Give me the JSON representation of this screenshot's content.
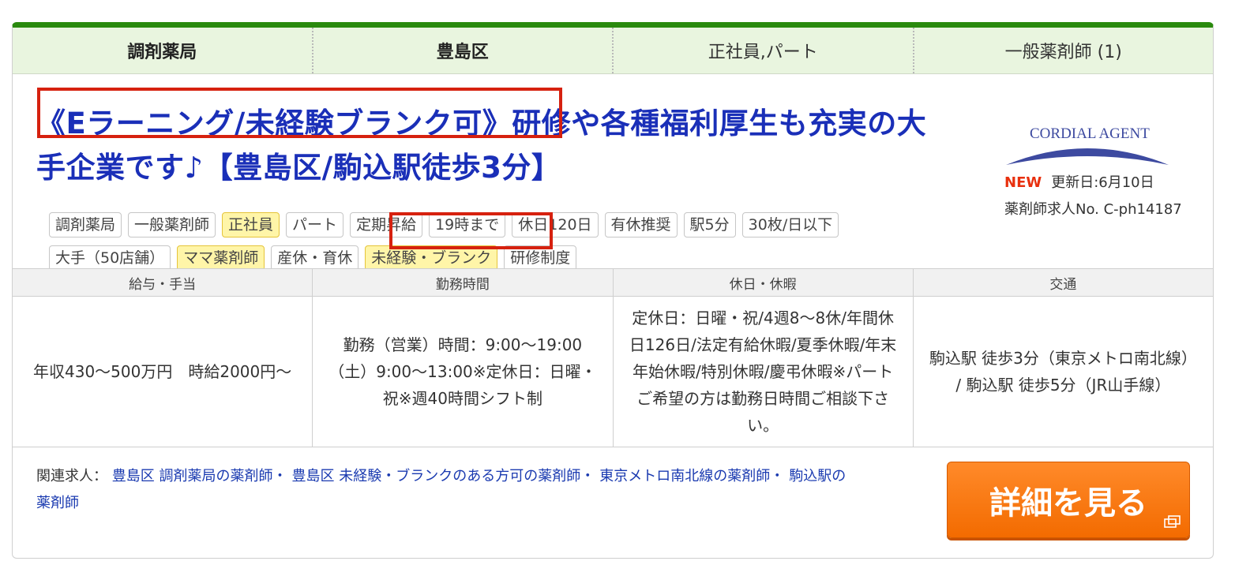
{
  "categories": [
    {
      "label": "調剤薬局",
      "bold": true
    },
    {
      "label": "豊島区",
      "bold": true
    },
    {
      "label": "正社員,パート",
      "bold": false
    },
    {
      "label": "一般薬剤師 (1)",
      "bold": false
    }
  ],
  "title": "《Eラーニング/未経験ブランク可》研修や各種福利厚生も充実の大手企業です♪【豊島区/駒込駅徒歩3分】",
  "logo_text": "CORDIAL AGENT",
  "badge_new": "NEW",
  "updated": "更新日:6月10日",
  "job_no": "薬剤師求人No. C-ph14187",
  "tags_row1": [
    {
      "label": "調剤薬局",
      "yellow": false
    },
    {
      "label": "一般薬剤師",
      "yellow": false
    },
    {
      "label": "正社員",
      "yellow": true
    },
    {
      "label": "パート",
      "yellow": false
    },
    {
      "label": "定期昇給",
      "yellow": false
    },
    {
      "label": "19時まで",
      "yellow": false
    },
    {
      "label": "休日120日",
      "yellow": false
    },
    {
      "label": "有休推奨",
      "yellow": false
    },
    {
      "label": "駅5分",
      "yellow": false
    },
    {
      "label": "30枚/日以下",
      "yellow": false
    }
  ],
  "tags_row2": [
    {
      "label": "大手（50店舗）",
      "yellow": false
    },
    {
      "label": "ママ薬剤師",
      "yellow": true
    },
    {
      "label": "産休・育休",
      "yellow": false
    },
    {
      "label": "未経験・ブランク",
      "yellow": true
    },
    {
      "label": "研修制度",
      "yellow": false
    }
  ],
  "grid_headers": [
    "給与・手当",
    "勤務時間",
    "休日・休暇",
    "交通"
  ],
  "grid_cells": [
    "年収430～500万円　時給2000円～",
    "勤務（営業）時間：9:00～19:00（土）9:00～13:00※定休日：日曜・祝※週40時間シフト制",
    "定休日：日曜・祝/4週8～8休/年間休日126日/法定有給休暇/夏季休暇/年末年始休暇/特別休暇/慶弔休暇※パートご希望の方は勤務日時間ご相談下さい。",
    "駒込駅 徒歩3分（東京メトロ南北線） / 駒込駅 徒歩5分（JR山手線）"
  ],
  "related_label": "関連求人：",
  "related_links": [
    "豊島区 調剤薬局の薬剤師・",
    "豊島区 未経験・ブランクのある方可の薬剤師・",
    "東京メトロ南北線の薬剤師・",
    "駒込駅の薬剤師"
  ],
  "detail_button": "詳細を見る",
  "colors": {
    "accent_green": "#2a8a0e",
    "title_blue": "#1a2fb8",
    "highlight_red": "#d6210f",
    "button_orange": "#f36b00"
  }
}
